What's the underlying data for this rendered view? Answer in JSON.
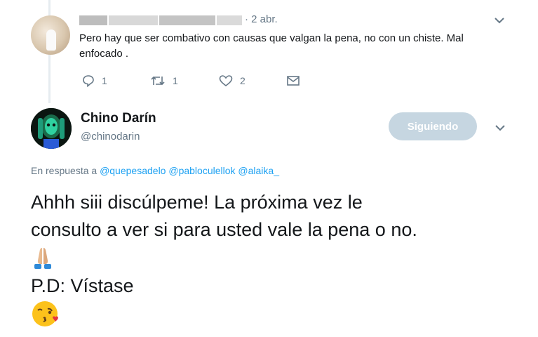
{
  "reply": {
    "date": "· 2 abr.",
    "text": "Pero hay que ser combativo con causas que valgan la pena, no con un chiste. Mal enfocado .",
    "actions": {
      "replies": "1",
      "retweets": "1",
      "likes": "2"
    }
  },
  "tweet": {
    "author_name": "Chino Darín",
    "author_handle": "@chinodarin",
    "follow_button": "Siguiendo",
    "reply_prefix": "En respuesta a",
    "mentions": [
      "@quepesadelo",
      "@pabloculellok",
      "@alaika_"
    ],
    "lines": [
      "Ahhh siii discúlpeme! La próxima vez le",
      "consulto a ver si para usted vale la pena o no.",
      "P.D: Vístase"
    ],
    "emojis": [
      "folded-hands-icon",
      "face-blowing-kiss-icon"
    ]
  },
  "colors": {
    "link": "#1da1f2",
    "secondary_text": "#657786",
    "follow_button_bg": "#c6d6e1"
  }
}
